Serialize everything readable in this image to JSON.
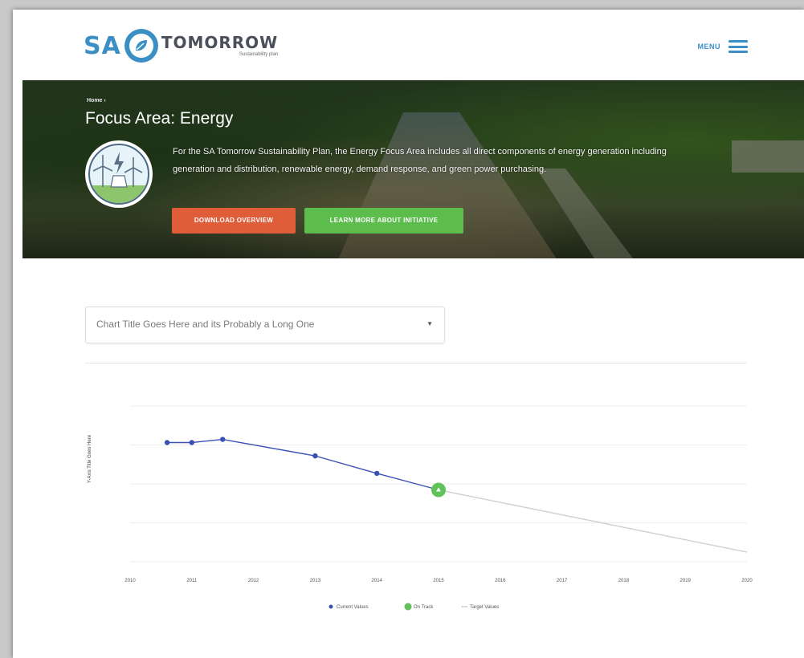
{
  "header": {
    "logo": {
      "sa": "SA",
      "tomorrow": "TOMORROW",
      "sub": "Sustainability plan"
    },
    "menu_label": "MENU"
  },
  "hero": {
    "breadcrumb": "Home ›",
    "title": "Focus Area: Energy",
    "description": "For the SA Tomorrow Sustainability Plan, the Energy Focus Area includes all direct components of energy generation including generation and distribution, renewable energy, demand response, and green power purchasing.",
    "buttons": {
      "download": "Download Overview",
      "learn_more": "Learn More About Initiative"
    },
    "colors": {
      "download": "#e05d3a",
      "learn_more": "#5cbd4c"
    }
  },
  "chart_select": {
    "value": "Chart Title Goes Here and its Probably a Long One"
  },
  "chart_data": {
    "type": "line",
    "ylabel": "Y-Axis Title Goes Here",
    "xlabel": "",
    "categories": [
      "2010",
      "2011",
      "2012",
      "2013",
      "2014",
      "2015",
      "2016",
      "2017",
      "2018",
      "2019",
      "2020"
    ],
    "ylim": [
      0,
      5
    ],
    "grid": true,
    "legend_position": "bottom-center",
    "series": [
      {
        "name": "Current Values",
        "color": "#3a50b4",
        "points": [
          [
            2010.6,
            3.75
          ],
          [
            2011,
            3.75
          ],
          [
            2011.5,
            3.85
          ],
          [
            2013,
            3.33
          ],
          [
            2014,
            2.78
          ],
          [
            2015,
            2.26
          ]
        ]
      },
      {
        "name": "On Track",
        "color": "#62c25a",
        "points": [
          [
            2015,
            2.26
          ]
        ]
      },
      {
        "name": "Target Values",
        "color": "#cfcfcf",
        "points": [
          [
            2015,
            2.26
          ],
          [
            2020,
            0.3
          ]
        ]
      }
    ]
  }
}
